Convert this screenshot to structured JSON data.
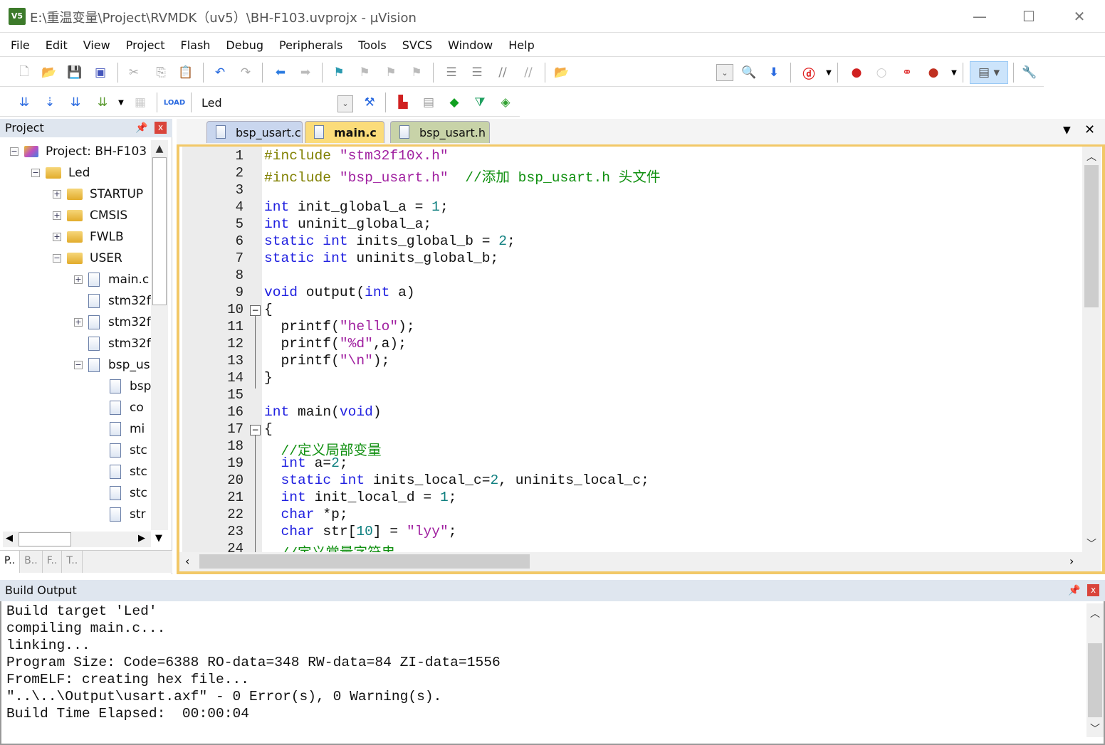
{
  "window": {
    "title": "E:\\重温变量\\Project\\RVMDK（uv5）\\BH-F103.uvprojx - µVision",
    "app_icon_label": "V5"
  },
  "menu": [
    "File",
    "Edit",
    "View",
    "Project",
    "Flash",
    "Debug",
    "Peripherals",
    "Tools",
    "SVCS",
    "Window",
    "Help"
  ],
  "toolbar": {
    "target": "Led"
  },
  "project_panel": {
    "title": "Project",
    "tree": [
      {
        "label": "Project: BH-F103",
        "indent": 0,
        "exp": "−",
        "kind": "project"
      },
      {
        "label": "Led",
        "indent": 1,
        "exp": "−",
        "kind": "folder"
      },
      {
        "label": "STARTUP",
        "indent": 2,
        "exp": "+",
        "kind": "folder"
      },
      {
        "label": "CMSIS",
        "indent": 2,
        "exp": "+",
        "kind": "folder"
      },
      {
        "label": "FWLB",
        "indent": 2,
        "exp": "+",
        "kind": "folder"
      },
      {
        "label": "USER",
        "indent": 2,
        "exp": "−",
        "kind": "folder"
      },
      {
        "label": "main.c",
        "indent": 3,
        "exp": "+",
        "kind": "file"
      },
      {
        "label": "stm32f",
        "indent": 3,
        "exp": "",
        "kind": "file"
      },
      {
        "label": "stm32f",
        "indent": 3,
        "exp": "+",
        "kind": "file"
      },
      {
        "label": "stm32f",
        "indent": 3,
        "exp": "",
        "kind": "file"
      },
      {
        "label": "bsp_us",
        "indent": 3,
        "exp": "−",
        "kind": "file"
      },
      {
        "label": "bsp",
        "indent": 4,
        "exp": "",
        "kind": "file"
      },
      {
        "label": "co",
        "indent": 4,
        "exp": "",
        "kind": "file"
      },
      {
        "label": "mi",
        "indent": 4,
        "exp": "",
        "kind": "file"
      },
      {
        "label": "stc",
        "indent": 4,
        "exp": "",
        "kind": "file"
      },
      {
        "label": "stc",
        "indent": 4,
        "exp": "",
        "kind": "file"
      },
      {
        "label": "stc",
        "indent": 4,
        "exp": "",
        "kind": "file"
      },
      {
        "label": "str",
        "indent": 4,
        "exp": "",
        "kind": "file"
      }
    ],
    "tabs": [
      "P..",
      "B..",
      "F..",
      "T.."
    ]
  },
  "editor": {
    "tabs": [
      {
        "label": "bsp_usart.c",
        "bg": "#c9d6ee"
      },
      {
        "label": "main.c",
        "bg": "#fbdc7a",
        "active": true
      },
      {
        "label": "bsp_usart.h",
        "bg": "#c8d3a8"
      }
    ],
    "lines": [
      [
        [
          "pp",
          "#include "
        ],
        [
          "str",
          "\"stm32f10x.h\""
        ]
      ],
      [
        [
          "pp",
          "#include "
        ],
        [
          "str",
          "\"bsp_usart.h\""
        ],
        [
          "txt",
          "  "
        ],
        [
          "cmt",
          "//添加 bsp_usart.h 头文件"
        ]
      ],
      [],
      [
        [
          "kw",
          "int"
        ],
        [
          "txt",
          " init_global_a = "
        ],
        [
          "num",
          "1"
        ],
        [
          "txt",
          ";"
        ]
      ],
      [
        [
          "kw",
          "int"
        ],
        [
          "txt",
          " uninit_global_a;"
        ]
      ],
      [
        [
          "kw",
          "static int"
        ],
        [
          "txt",
          " inits_global_b = "
        ],
        [
          "num",
          "2"
        ],
        [
          "txt",
          ";"
        ]
      ],
      [
        [
          "kw",
          "static int"
        ],
        [
          "txt",
          " uninits_global_b;"
        ]
      ],
      [],
      [
        [
          "kw",
          "void"
        ],
        [
          "txt",
          " output("
        ],
        [
          "kw",
          "int"
        ],
        [
          "txt",
          " a)"
        ]
      ],
      [
        [
          "txt",
          "{"
        ]
      ],
      [
        [
          "txt",
          "  printf("
        ],
        [
          "str",
          "\"hello\""
        ],
        [
          "txt",
          ");"
        ]
      ],
      [
        [
          "txt",
          "  printf("
        ],
        [
          "str",
          "\"%d\""
        ],
        [
          "txt",
          ",a);"
        ]
      ],
      [
        [
          "txt",
          "  printf("
        ],
        [
          "str",
          "\"\\n\""
        ],
        [
          "txt",
          ");"
        ]
      ],
      [
        [
          "txt",
          "}"
        ]
      ],
      [],
      [
        [
          "kw",
          "int"
        ],
        [
          "txt",
          " main("
        ],
        [
          "kw",
          "void"
        ],
        [
          "txt",
          ")"
        ]
      ],
      [
        [
          "txt",
          "{"
        ]
      ],
      [
        [
          "txt",
          "  "
        ],
        [
          "cmt",
          "//定义局部变量"
        ]
      ],
      [
        [
          "txt",
          "  "
        ],
        [
          "kw",
          "int"
        ],
        [
          "txt",
          " a="
        ],
        [
          "num",
          "2"
        ],
        [
          "txt",
          ";"
        ]
      ],
      [
        [
          "txt",
          "  "
        ],
        [
          "kw",
          "static int"
        ],
        [
          "txt",
          " inits_local_c="
        ],
        [
          "num",
          "2"
        ],
        [
          "txt",
          ", uninits_local_c;"
        ]
      ],
      [
        [
          "txt",
          "  "
        ],
        [
          "kw",
          "int"
        ],
        [
          "txt",
          " init_local_d = "
        ],
        [
          "num",
          "1"
        ],
        [
          "txt",
          ";"
        ]
      ],
      [
        [
          "txt",
          "  "
        ],
        [
          "kw",
          "char"
        ],
        [
          "txt",
          " *p;"
        ]
      ],
      [
        [
          "txt",
          "  "
        ],
        [
          "kw",
          "char"
        ],
        [
          "txt",
          " str["
        ],
        [
          "num",
          "10"
        ],
        [
          "txt",
          "] = "
        ],
        [
          "str",
          "\"lyy\""
        ],
        [
          "txt",
          ";"
        ]
      ],
      [
        [
          "txt",
          "  "
        ],
        [
          "cmt",
          "//定义常量字符串"
        ]
      ]
    ]
  },
  "build_output": {
    "title": "Build Output",
    "lines": [
      "Build target 'Led'",
      "compiling main.c...",
      "linking...",
      "Program Size: Code=6388 RO-data=348 RW-data=84 ZI-data=1556",
      "FromELF: creating hex file...",
      "\"..\\..\\Output\\usart.axf\" - 0 Error(s), 0 Warning(s).",
      "Build Time Elapsed:  00:00:04"
    ]
  }
}
